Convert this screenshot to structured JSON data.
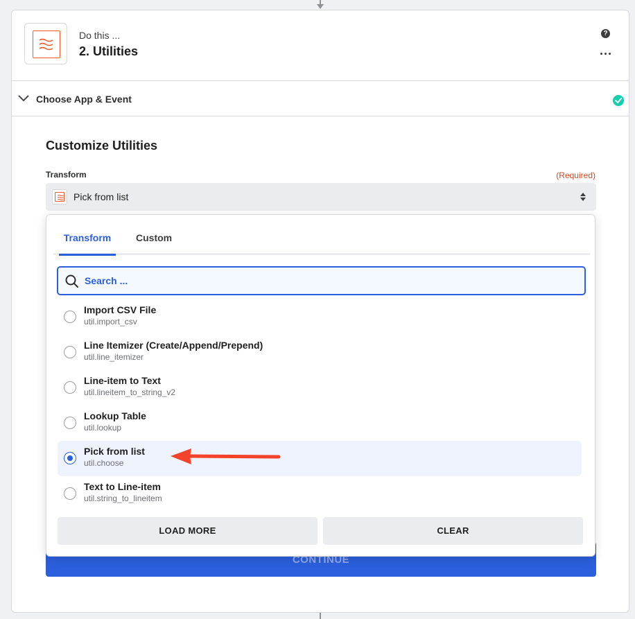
{
  "step": {
    "do_this": "Do this ...",
    "title": "2. Utilities",
    "help_glyph": "?",
    "app_icon": "utilities-app-icon"
  },
  "section": {
    "label": "Choose App & Event",
    "status": "complete",
    "status_color": "#13d0ab"
  },
  "form": {
    "title": "Customize Utilities",
    "field_label": "Transform",
    "required_label": "(Required)",
    "selected_value": "Pick from list",
    "continue_label": "CONTINUE"
  },
  "dropdown": {
    "tabs": [
      {
        "label": "Transform",
        "active": true
      },
      {
        "label": "Custom",
        "active": false
      }
    ],
    "search_placeholder": "Search ...",
    "options": [
      {
        "title": "Import CSV File",
        "subtitle": "util.import_csv",
        "selected": false
      },
      {
        "title": "Line Itemizer (Create/Append/Prepend)",
        "subtitle": "util.line_itemizer",
        "selected": false
      },
      {
        "title": "Line-item to Text",
        "subtitle": "util.lineitem_to_string_v2",
        "selected": false
      },
      {
        "title": "Lookup Table",
        "subtitle": "util.lookup",
        "selected": false
      },
      {
        "title": "Pick from list",
        "subtitle": "util.choose",
        "selected": true
      },
      {
        "title": "Text to Line-item",
        "subtitle": "util.string_to_lineitem",
        "selected": false
      }
    ],
    "load_more_label": "LOAD MORE",
    "clear_label": "CLEAR"
  },
  "colors": {
    "accent": "#2b5fdb",
    "brand": "#f25c2a",
    "annotation_arrow": "#f4432b",
    "required": "#d0471e"
  }
}
